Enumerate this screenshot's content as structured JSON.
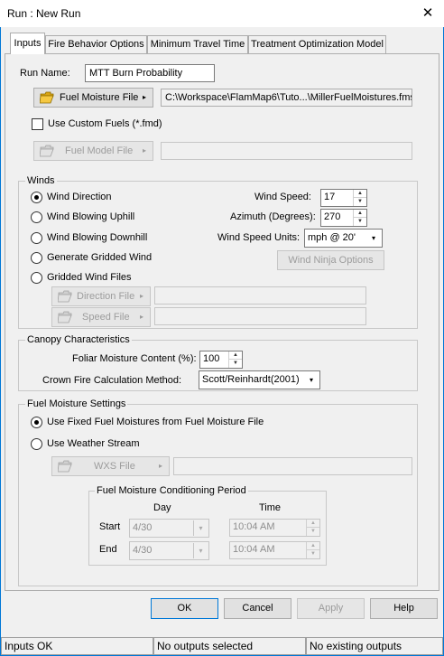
{
  "window": {
    "title": "Run : New Run",
    "close_glyph": "✕"
  },
  "tabs": [
    {
      "label": "Inputs"
    },
    {
      "label": "Fire Behavior Options"
    },
    {
      "label": "Minimum Travel Time"
    },
    {
      "label": "Treatment Optimization Model"
    }
  ],
  "inputs": {
    "run_name_label": "Run Name:",
    "run_name_value": "MTT Burn Probability",
    "fuel_moisture_button": "Fuel Moisture File",
    "fuel_moisture_path": "C:\\Workspace\\FlamMap6\\Tuto...\\MillerFuelMoistures.fms",
    "custom_fuels_label": "Use Custom Fuels (*.fmd)",
    "custom_fuels_checked": false,
    "fuel_model_button": "Fuel Model File",
    "fuel_model_path": ""
  },
  "winds": {
    "group_title": "Winds",
    "options": [
      {
        "label": "Wind Direction",
        "selected": true
      },
      {
        "label": "Wind Blowing Uphill",
        "selected": false
      },
      {
        "label": "Wind Blowing Downhill",
        "selected": false
      },
      {
        "label": "Generate Gridded Wind",
        "selected": false
      },
      {
        "label": "Gridded Wind Files",
        "selected": false
      }
    ],
    "speed_label": "Wind Speed:",
    "speed_value": "17",
    "azimuth_label": "Azimuth (Degrees):",
    "azimuth_value": "270",
    "units_label": "Wind Speed Units:",
    "units_value": "mph @ 20'",
    "windninja_button": "Wind Ninja Options",
    "direction_file_button": "Direction File",
    "direction_file_path": "",
    "speed_file_button": "Speed File",
    "speed_file_path": ""
  },
  "canopy": {
    "group_title": "Canopy Characteristics",
    "foliar_label": "Foliar Moisture Content (%):",
    "foliar_value": "100",
    "crown_label": "Crown Fire Calculation Method:",
    "crown_value": "Scott/Reinhardt(2001)"
  },
  "fuel_moisture_settings": {
    "group_title": "Fuel Moisture Settings",
    "options": [
      {
        "label": "Use Fixed Fuel Moistures from Fuel Moisture File",
        "selected": true
      },
      {
        "label": "Use Weather Stream",
        "selected": false
      }
    ],
    "wxs_button": "WXS File",
    "wxs_path": "",
    "conditioning": {
      "title": "Fuel Moisture Conditioning Period",
      "day_header": "Day",
      "time_header": "Time",
      "start_label": "Start",
      "start_day": "4/30",
      "start_time": "10:04 AM",
      "end_label": "End",
      "end_day": "4/30",
      "end_time": "10:04 AM"
    }
  },
  "buttons": {
    "ok": "OK",
    "cancel": "Cancel",
    "apply": "Apply",
    "help": "Help"
  },
  "statusbar": {
    "inputs": "Inputs OK",
    "outputs": "No outputs selected",
    "existing": "No existing outputs"
  },
  "icons": {
    "folder": "folder-open-icon",
    "arrow": "▸",
    "down": "▾",
    "up": "▲",
    "dn": "▼"
  }
}
